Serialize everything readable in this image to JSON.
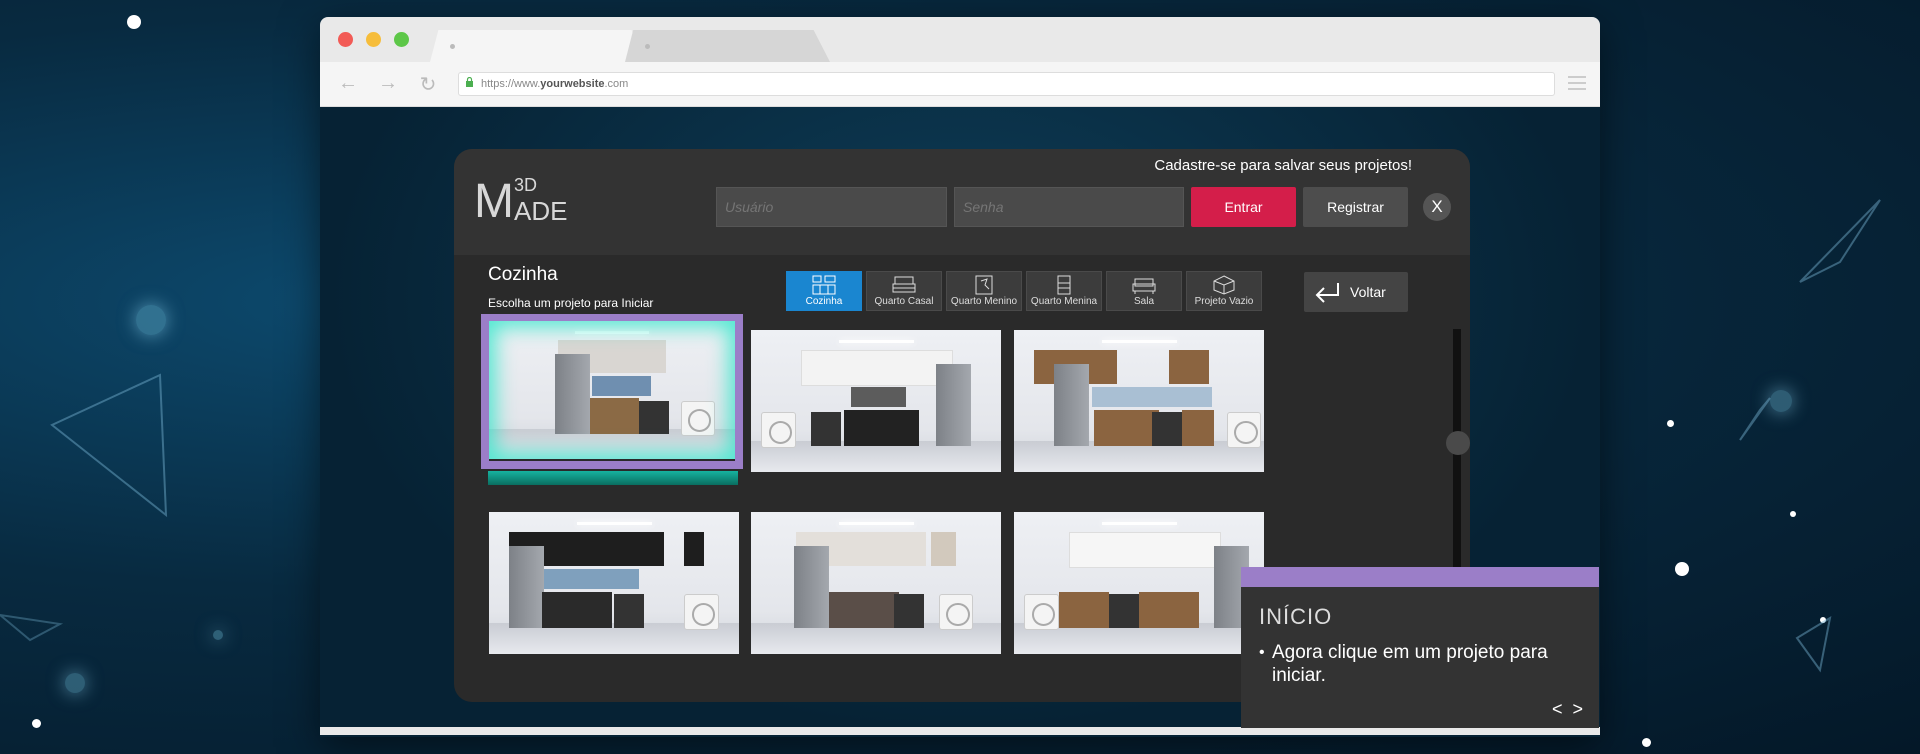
{
  "browser": {
    "url_prefix": "https://www.",
    "url_domain": "yourwebsite",
    "url_suffix": ".com"
  },
  "app": {
    "logo_top": "3D",
    "logo_m": "M",
    "logo_rest": "ADE",
    "register_note": "Cadastre-se para salvar seus projetos!",
    "username_placeholder": "Usuário",
    "password_placeholder": "Senha",
    "enter_label": "Entrar",
    "register_label": "Registrar",
    "close_label": "X",
    "section_title": "Cozinha",
    "section_subtitle": "Escolha um projeto para Iniciar",
    "back_label": "Voltar",
    "categories": [
      {
        "label": "Cozinha",
        "icon": "kitchen-icon",
        "selected": true
      },
      {
        "label": "Quarto Casal",
        "icon": "bed-icon",
        "selected": false
      },
      {
        "label": "Quarto Menino",
        "icon": "kids-room-icon",
        "selected": false
      },
      {
        "label": "Quarto Menina",
        "icon": "wardrobe-icon",
        "selected": false
      },
      {
        "label": "Sala",
        "icon": "sofa-icon",
        "selected": false
      },
      {
        "label": "Projeto Vazio",
        "icon": "empty-box-icon",
        "selected": false
      }
    ],
    "projects": [
      {
        "name": "kitchen-project-1",
        "highlighted": true
      },
      {
        "name": "kitchen-project-2",
        "highlighted": false
      },
      {
        "name": "kitchen-project-3",
        "highlighted": false
      },
      {
        "name": "kitchen-project-4",
        "highlighted": false
      },
      {
        "name": "kitchen-project-5",
        "highlighted": false
      },
      {
        "name": "kitchen-project-6",
        "highlighted": false
      }
    ]
  },
  "tutorial": {
    "title": "INÍCIO",
    "bullet": "•",
    "body": "Agora clique em um projeto para iniciar.",
    "prev": "<",
    "next": ">",
    "accent_color": "#9b7ec8"
  },
  "colors": {
    "primary_button": "#d41e4a",
    "selected_category": "#1a86d0",
    "highlight": "#9b7ec8"
  }
}
